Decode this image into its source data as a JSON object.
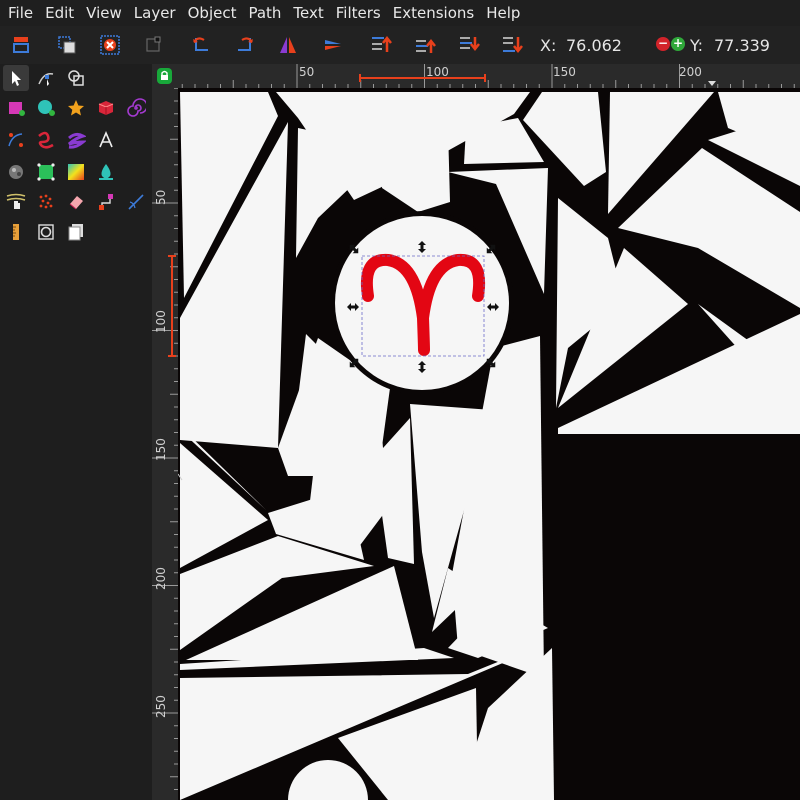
{
  "menu": [
    "File",
    "Edit",
    "View",
    "Layer",
    "Object",
    "Path",
    "Text",
    "Filters",
    "Extensions",
    "Help"
  ],
  "controls": {
    "x_label": "X:",
    "x_value": "76.062",
    "y_label": "Y:",
    "y_value": "77.339",
    "minus": "−",
    "plus": "+"
  },
  "toolbox": {
    "tools": [
      "selector-tool",
      "node-tool",
      "shape-builder-tool",
      "rectangle-tool",
      "ellipse-tool",
      "star-tool",
      "box-3d-tool",
      "spiral-tool",
      "pen-tool",
      "calligraphy-tool",
      "text-tool-alt",
      "text-tool",
      "dropper-tool",
      "mesh-tool",
      "gradient-tool",
      "paint-bucket-tool",
      "tweak-tool",
      "spray-tool",
      "eraser-tool",
      "connector-tool",
      "measure-tool",
      "ruler-tool",
      "zoom-tool",
      "pages-tool"
    ]
  },
  "rulers": {
    "horizontal": [
      "50",
      "100",
      "150",
      "200"
    ],
    "vertical": [
      "50",
      "100",
      "150",
      "200",
      "250"
    ]
  },
  "colors": {
    "selection_accent": "#e8401c",
    "aries_symbol": "#e30613",
    "canvas_black": "#0a0606",
    "canvas_white": "#f6f6f6",
    "lock_green": "#18a83a"
  },
  "canvas": {
    "selected_object": "aries-symbol"
  }
}
